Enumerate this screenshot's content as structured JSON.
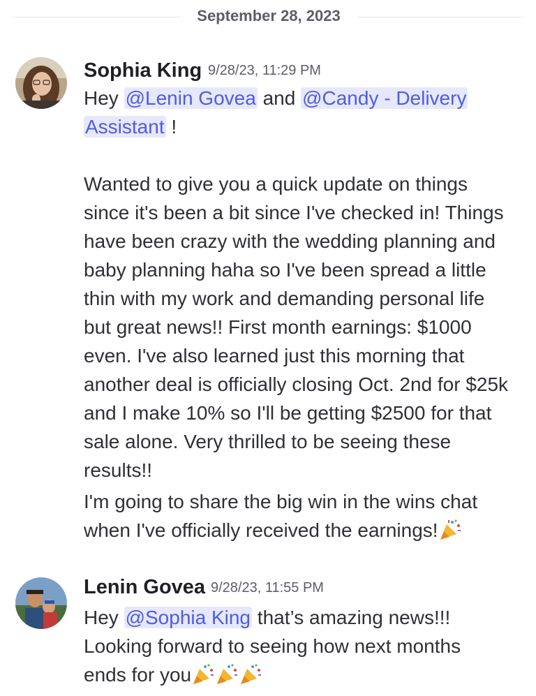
{
  "divider": {
    "date": "September 28, 2023"
  },
  "messages": [
    {
      "author": "Sophia King",
      "timestamp": "9/28/23, 11:29 PM",
      "line1_pre": "Hey ",
      "mention1": "@Lenin Govea",
      "line1_mid": " and ",
      "mention2a": "@Candy - Delivery",
      "mention2b": "Assistant",
      "line2_post": " !",
      "paragraph1": "Wanted to give you a quick update on things since it's been a bit since I've checked in! Things have been crazy with the wedding planning and baby planning haha so I've been spread a little thin with my work and demanding personal life but great news!! First month earnings: $1000 even. I've also learned just this morning that another deal is officially closing Oct. 2nd for $25k and I make 10% so I'll be getting $2500 for that sale alone. Very thrilled to be seeing these results!!",
      "paragraph2": "I'm going to share the big win in the wins chat when I've officially received the earnings!",
      "emoji": "party-popper"
    },
    {
      "author": "Lenin Govea",
      "timestamp": "9/28/23, 11:55 PM",
      "pre": "Hey ",
      "mention": "@Sophia King",
      "post": " that’s amazing news!!!",
      "line2": "Looking forward to seeing how next months",
      "line3": "ends for you",
      "emoji": "party-popper"
    }
  ],
  "colors": {
    "mention_bg": "#e6e8fd",
    "mention_text": "#505cdc",
    "text": "#2e3035",
    "muted": "#5c5e66"
  }
}
